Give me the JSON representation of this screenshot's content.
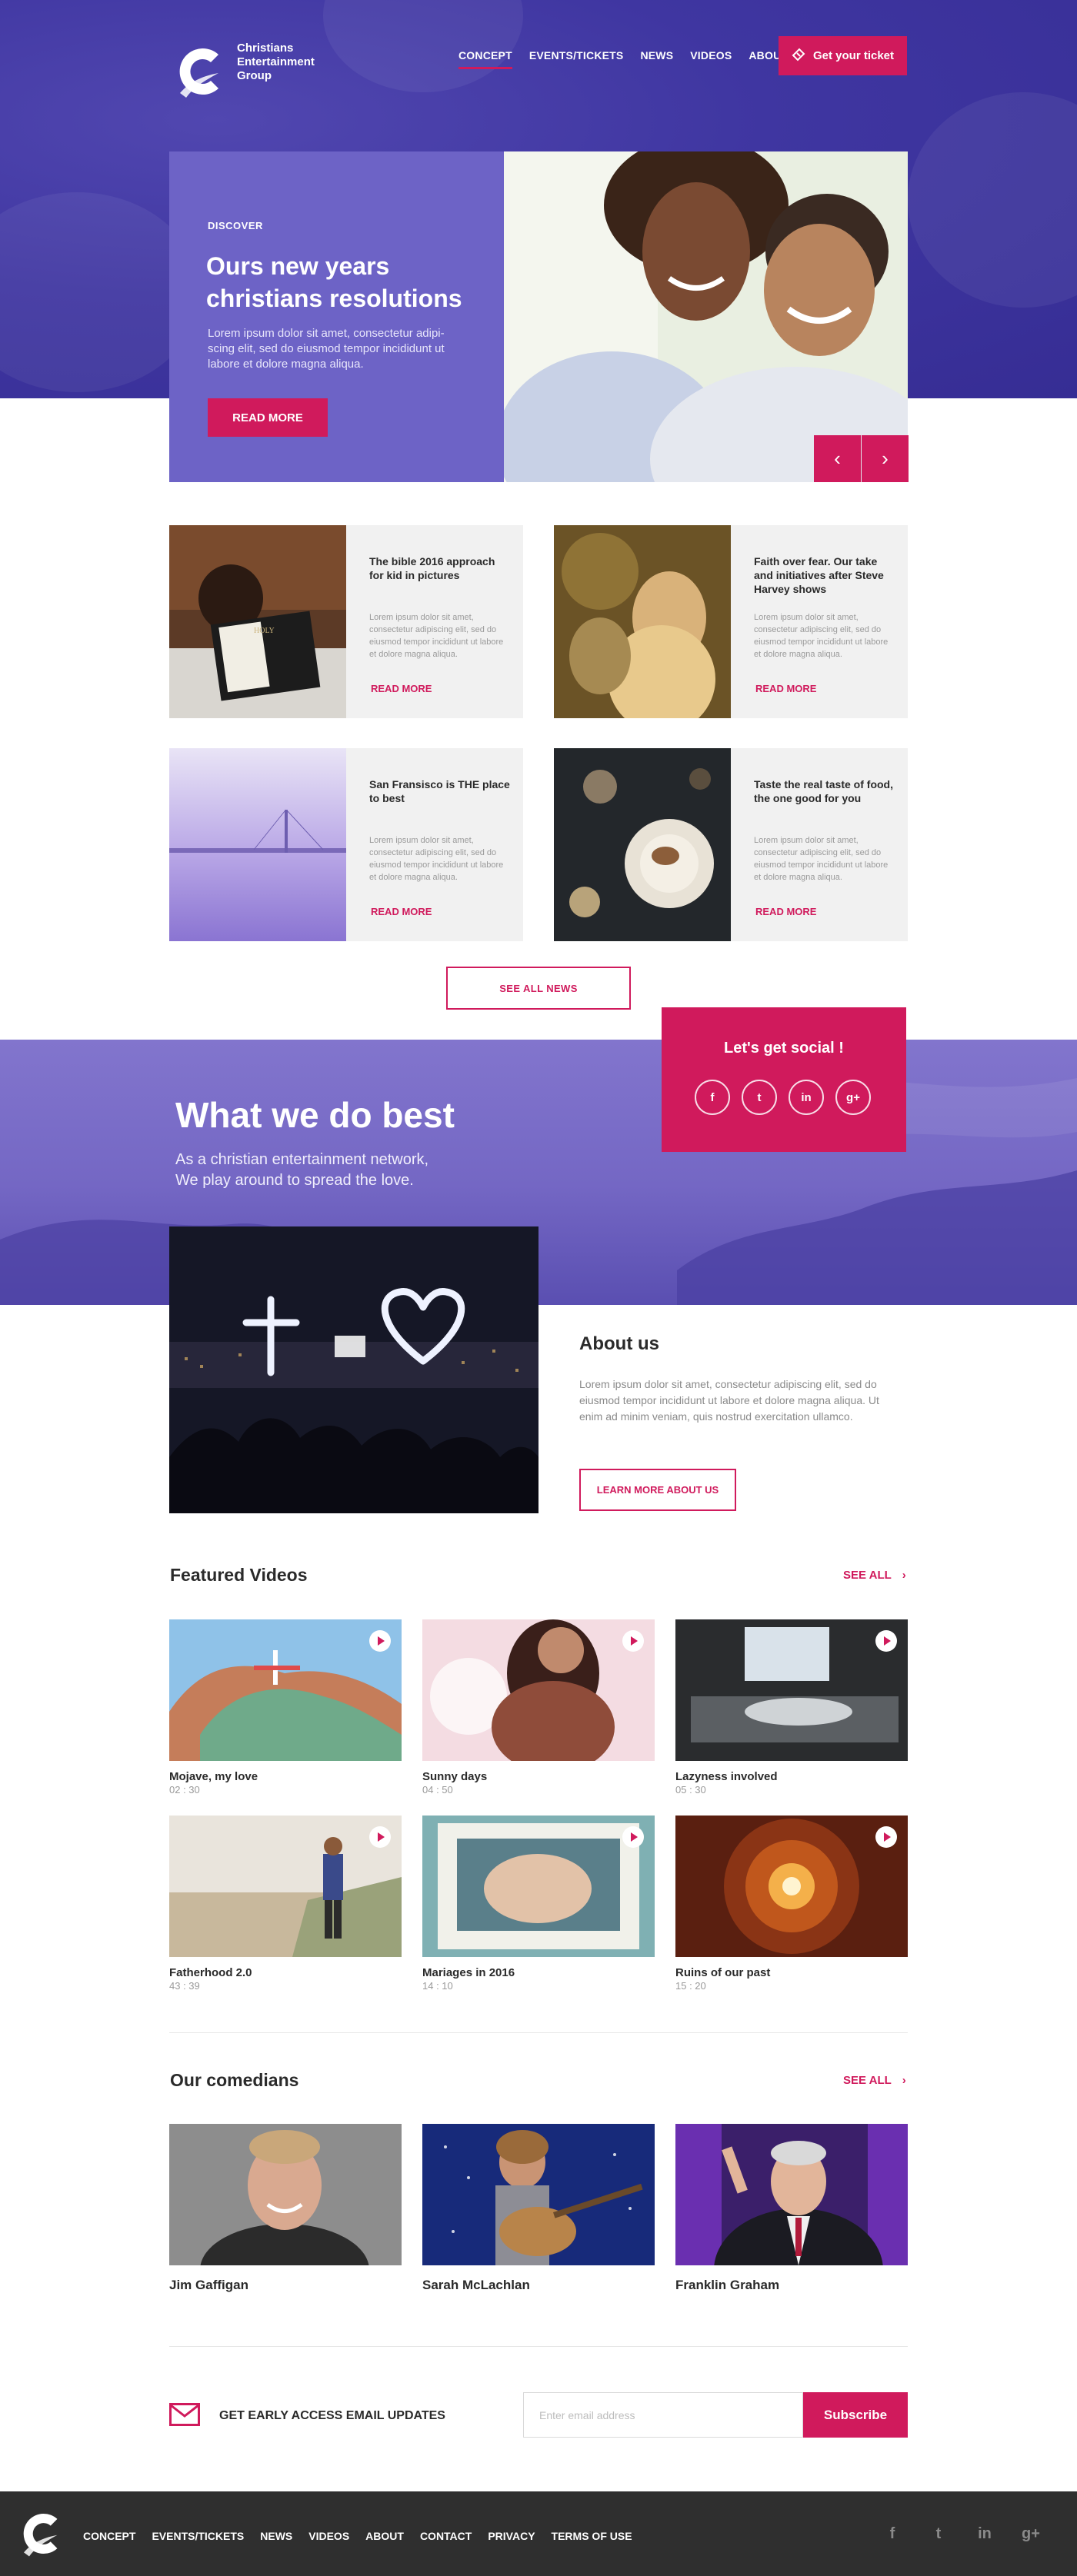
{
  "brand": {
    "name_line1": "Christians",
    "name_line2": "Entertainment",
    "name_line3": "Group"
  },
  "nav": {
    "items": [
      "CONCEPT",
      "EVENTS/TICKETS",
      "NEWS",
      "VIDEOS",
      "ABOUT"
    ],
    "active": "CONCEPT",
    "cta_label": "Get your ticket"
  },
  "hero": {
    "kicker": "DISCOVER",
    "title": "Ours new years christians resolutions",
    "body": "Lorem ipsum dolor sit amet, consectetur adipi-scing elit, sed do eiusmod tempor incididunt ut labore et dolore magna aliqua.",
    "button_label": "READ MORE",
    "prev_label": "‹",
    "next_label": "›"
  },
  "news": {
    "cards": [
      {
        "title": "The bible 2016 approach for kid in pictures",
        "body": "Lorem ipsum dolor sit amet, consectetur adipiscing elit, sed do eiusmod tempor incididunt ut labore et dolore magna aliqua.",
        "link": "READ MORE"
      },
      {
        "title": "Faith over fear. Our take and initiatives after Steve Harvey shows",
        "body": "Lorem ipsum dolor sit amet, consectetur adipiscing elit, sed do eiusmod tempor incididunt ut labore et dolore magna aliqua.",
        "link": "READ MORE"
      },
      {
        "title": "San Fransisco is THE place to best",
        "body": "Lorem ipsum dolor sit amet, consectetur adipiscing elit, sed do eiusmod tempor incididunt ut labore et dolore magna aliqua.",
        "link": "READ MORE"
      },
      {
        "title": "Taste the real taste of food, the one good for you",
        "body": "Lorem ipsum dolor sit amet, consectetur adipiscing elit, sed do eiusmod tempor incididunt ut labore et dolore magna aliqua.",
        "link": "READ MORE"
      }
    ],
    "see_all_label": "SEE ALL NEWS"
  },
  "best": {
    "title": "What we do best",
    "subtitle_line1": "As a christian entertainment network,",
    "subtitle_line2": "We play around to spread the love."
  },
  "social": {
    "title": "Let's get social !",
    "icons": [
      "facebook-icon",
      "twitter-icon",
      "linkedin-icon",
      "google-plus-icon"
    ],
    "glyphs": [
      "f",
      "t",
      "in",
      "g+"
    ]
  },
  "about": {
    "title": "About us",
    "body": "Lorem ipsum dolor sit amet, consectetur adipiscing elit, sed do eiusmod tempor incididunt ut labore et dolore magna aliqua. Ut enim ad minim veniam, quis nostrud exercitation ullamco.",
    "button_label": "LEARN MORE ABOUT US"
  },
  "videos": {
    "title": "Featured Videos",
    "see_all": "SEE ALL",
    "items": [
      {
        "title": "Mojave, my love",
        "duration": "02 : 30"
      },
      {
        "title": "Sunny days",
        "duration": "04 : 50"
      },
      {
        "title": "Lazyness involved",
        "duration": "05 : 30"
      },
      {
        "title": "Fatherhood 2.0",
        "duration": "43 : 39"
      },
      {
        "title": "Mariages in 2016",
        "duration": "14 : 10"
      },
      {
        "title": "Ruins of our past",
        "duration": "15 : 20"
      }
    ]
  },
  "comedians": {
    "title": "Our comedians",
    "see_all": "SEE ALL",
    "items": [
      {
        "name": "Jim Gaffigan"
      },
      {
        "name": "Sarah McLachlan"
      },
      {
        "name": "Franklin Graham"
      }
    ]
  },
  "newsletter": {
    "label": "GET EARLY ACCESS EMAIL UPDATES",
    "placeholder": "Enter email address",
    "value": "",
    "button_label": "Subscribe"
  },
  "footer": {
    "nav": [
      "CONCEPT",
      "EVENTS/TICKETS",
      "NEWS",
      "VIDEOS",
      "ABOUT",
      "CONTACT",
      "PRIVACY",
      "TERMS OF USE"
    ],
    "social_glyphs": [
      "f",
      "t",
      "in",
      "g+"
    ]
  },
  "colors": {
    "accent": "#d01a5c",
    "hero_purple": "#3f36a1",
    "band_purple": "#7467c4",
    "footer_bg": "#2f2f2f"
  }
}
